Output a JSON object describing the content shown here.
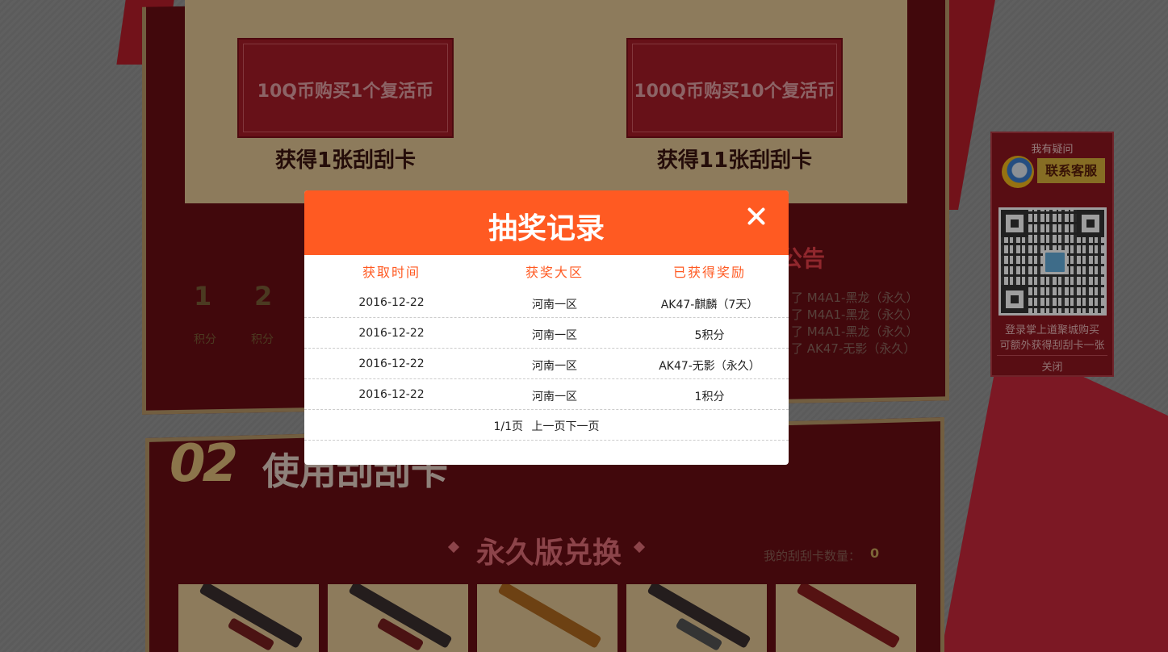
{
  "page": {
    "buy_cards": [
      {
        "label": "10Q币购买1个复活币",
        "reward": "获得1张刮刮卡"
      },
      {
        "label": "100Q币购买10个复活币",
        "reward": "获得11张刮刮卡"
      }
    ],
    "rank": {
      "numbers": [
        "1",
        "2"
      ],
      "unit": "积分"
    },
    "notice": {
      "title": "公告",
      "lines": [
        "了 M4A1-黑龙（永久）",
        "了 M4A1-黑龙（永久）",
        "了 M4A1-黑龙（永久）",
        "了 AK47-无影（永久）"
      ]
    },
    "section": {
      "number": "02",
      "title": "使用刮刮卡"
    },
    "exchange": {
      "title": "永久版兑换",
      "card_count_label": "我的刮刮卡数量：",
      "card_count": "0"
    }
  },
  "service": {
    "question": "我有疑问",
    "contact_button": "联系客服",
    "tip_line1": "登录掌上道聚城购买",
    "tip_line2": "可额外获得刮刮卡一张",
    "close": "关闭"
  },
  "modal": {
    "title": "抽奖记录",
    "columns": [
      "获取时间",
      "获奖大区",
      "已获得奖励"
    ],
    "rows": [
      {
        "time": "2016-12-22",
        "region": "河南一区",
        "reward": "AK47-麒麟（7天）"
      },
      {
        "time": "2016-12-22",
        "region": "河南一区",
        "reward": "5积分"
      },
      {
        "time": "2016-12-22",
        "region": "河南一区",
        "reward": "AK47-无影（永久）"
      },
      {
        "time": "2016-12-22",
        "region": "河南一区",
        "reward": "1积分"
      }
    ],
    "pager": {
      "page_info": "1/1页",
      "prev": "上一页",
      "next": "下一页"
    }
  },
  "colors": {
    "modal_header": "#ff5a22",
    "column_header_text": "#ff5a22",
    "panel_red": "#6a0d14",
    "gold_panel": "#e4c795"
  },
  "icons": {
    "close": "close-icon",
    "service_avatar": "customer-service-avatar-icon",
    "qr": "qr-code-image"
  }
}
